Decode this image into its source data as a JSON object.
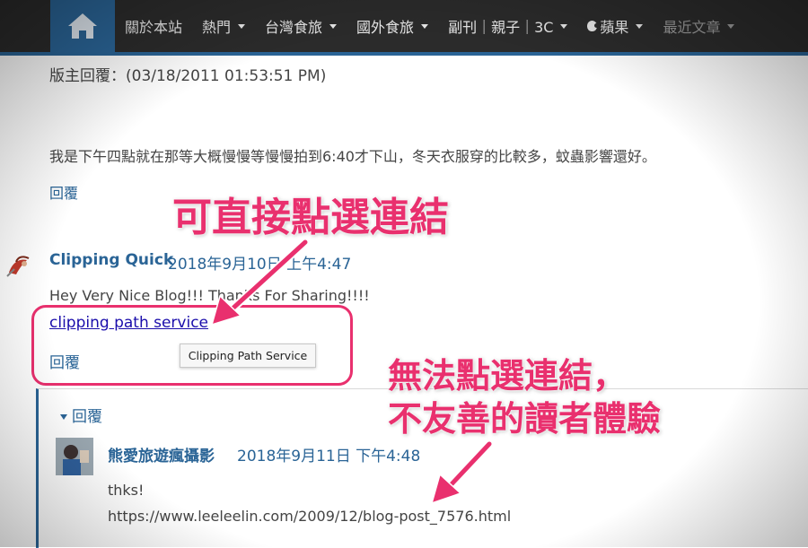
{
  "nav": {
    "home_icon": "home-icon",
    "items": [
      {
        "label": "關於本站",
        "dropdown": false
      },
      {
        "label": "熱門",
        "dropdown": true
      },
      {
        "label": "台灣食旅",
        "dropdown": true
      },
      {
        "label": "國外食旅",
        "dropdown": true
      },
      {
        "label": "副刊｜親子｜3C",
        "dropdown": true
      },
      {
        "label": "蘋果",
        "dropdown": true
      },
      {
        "label": "最近文章",
        "dropdown": true
      }
    ],
    "accent_color": "#2a6496"
  },
  "owner_reply": {
    "header": "版主回覆：(03/18/2011 01:53:51 PM)",
    "body": "我是下午四點就在那等大概慢慢等慢慢拍到6:40才下山，冬天衣服穿的比較多，蚊蟲影響還好。",
    "reply_link": "回覆"
  },
  "comment": {
    "author": "Clipping Quick",
    "date": "2018年9月10日 上午4:47",
    "text": "Hey Very Nice Blog!!! Thanks For Sharing!!!!",
    "link_text": "clipping path service",
    "tooltip": "Clipping Path Service",
    "reply_link": "回覆"
  },
  "thread": {
    "toggle_label": "回覆",
    "reply": {
      "author": "熊愛旅遊瘋攝影",
      "date": "2018年9月11日 下午4:48",
      "text": "thks!",
      "url_text": "https://www.leeleelin.com/2009/12/blog-post_7576.html"
    }
  },
  "annotations": {
    "clickable": "可直接點選連結",
    "not_clickable_line1": "無法點選連結，",
    "not_clickable_line2": "不友善的讀者體驗",
    "color": "#e9306e"
  }
}
